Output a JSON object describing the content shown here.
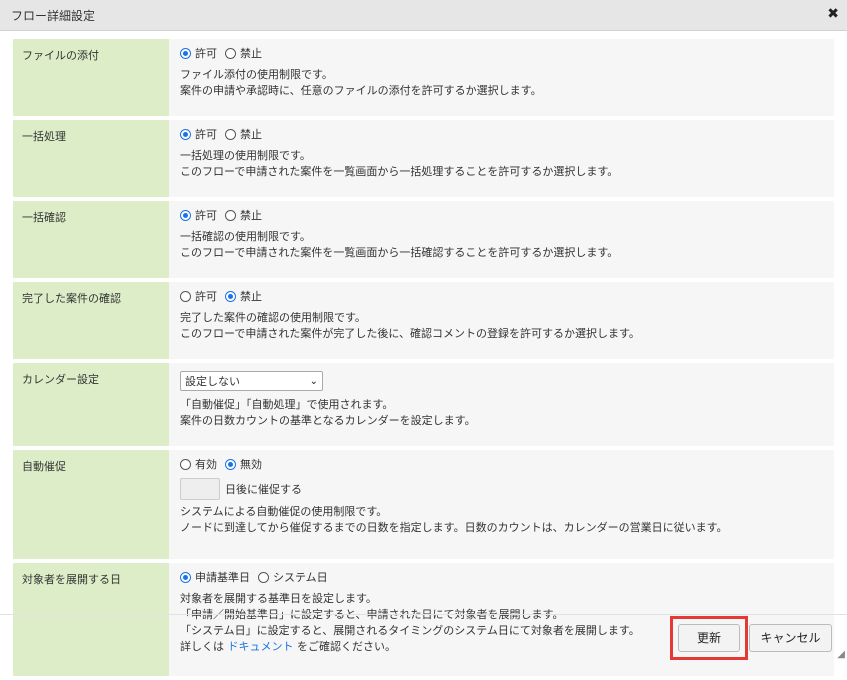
{
  "dialog": {
    "title": "フロー詳細設定",
    "close_symbol": "✖"
  },
  "rows": {
    "attachment": {
      "label": "ファイルの添付",
      "options": [
        "許可",
        "禁止"
      ],
      "selected": "許可",
      "desc1": "ファイル添付の使用制限です。",
      "desc2": "案件の申請や承認時に、任意のファイルの添付を許可するか選択します。"
    },
    "bulk_process": {
      "label": "一括処理",
      "options": [
        "許可",
        "禁止"
      ],
      "selected": "許可",
      "desc1": "一括処理の使用制限です。",
      "desc2": "このフローで申請された案件を一覧画面から一括処理することを許可するか選択します。"
    },
    "bulk_confirm": {
      "label": "一括確認",
      "options": [
        "許可",
        "禁止"
      ],
      "selected": "許可",
      "desc1": "一括確認の使用制限です。",
      "desc2": "このフローで申請された案件を一覧画面から一括確認することを許可するか選択します。"
    },
    "completed_confirm": {
      "label": "完了した案件の確認",
      "options": [
        "許可",
        "禁止"
      ],
      "selected": "禁止",
      "desc1": "完了した案件の確認の使用制限です。",
      "desc2": "このフローで申請された案件が完了した後に、確認コメントの登録を許可するか選択します。"
    },
    "calendar": {
      "label": "カレンダー設定",
      "select_value": "設定しない",
      "desc1": "「自動催促」「自動処理」で使用されます。",
      "desc2": "案件の日数カウントの基準となるカレンダーを設定します。"
    },
    "auto_remind": {
      "label": "自動催促",
      "options": [
        "有効",
        "無効"
      ],
      "selected": "無効",
      "days_value": "",
      "days_suffix": "日後に催促する",
      "desc1": "システムによる自動催促の使用制限です。",
      "desc2": "ノードに到達してから催促するまでの日数を指定します。日数のカウントは、カレンダーの営業日に従います。"
    },
    "target_expand": {
      "label": "対象者を展開する日",
      "options": [
        "申請基準日",
        "システム日"
      ],
      "selected": "申請基準日",
      "desc1": "対象者を展開する基準日を設定します。",
      "desc2": "「申請／開始基準日」に設定すると、申請された日にて対象者を展開します。",
      "desc3": "「システム日」に設定すると、展開されるタイミングのシステム日にて対象者を展開します。",
      "desc4_prefix": "詳しくは ",
      "desc4_link": "ドキュメント",
      "desc4_suffix": " をご確認ください。"
    }
  },
  "footer": {
    "update_label": "更新",
    "cancel_label": "キャンセル"
  },
  "colors": {
    "label_bg": "#dcedc8",
    "value_bg": "#f6f6f6",
    "accent": "#1a73e8",
    "highlight": "#e53935"
  }
}
